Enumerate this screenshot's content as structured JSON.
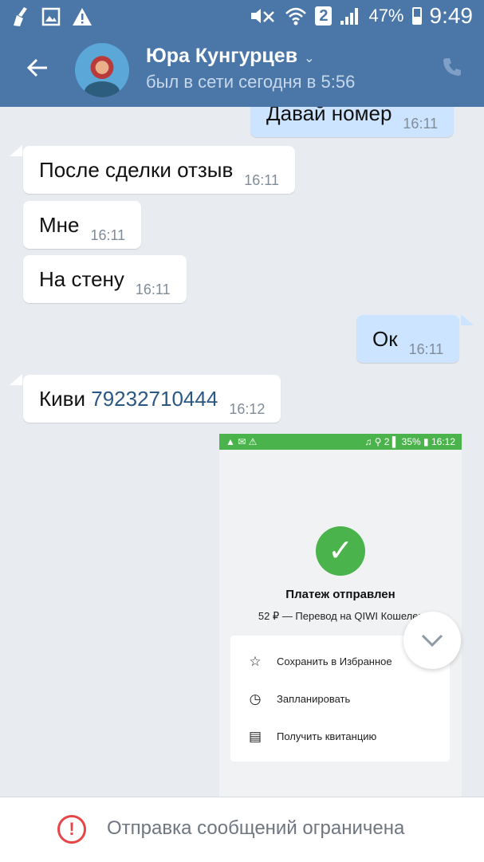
{
  "status_bar": {
    "left_icons": [
      "broom-icon",
      "image-icon",
      "warning-icon"
    ],
    "right_icons": [
      "mute-icon",
      "wifi-icon",
      "signal-icon"
    ],
    "sim": "2",
    "battery": "47%",
    "time": "9:49"
  },
  "header": {
    "contact_name": "Юра Кунгурцев",
    "last_seen": "был в сети сегодня в 5:56"
  },
  "messages": [
    {
      "direction": "out",
      "text": "Давай номер",
      "time": "16:11"
    },
    {
      "direction": "in",
      "text": "После сделки отзыв",
      "time": "16:11"
    },
    {
      "direction": "in",
      "text": "Мне",
      "time": "16:11"
    },
    {
      "direction": "in",
      "text": "На стену",
      "time": "16:11"
    },
    {
      "direction": "out",
      "text": "Ок",
      "time": "16:11"
    },
    {
      "direction": "in",
      "text": "Киви",
      "link": "79232710444",
      "time": "16:12"
    }
  ],
  "screenshot_attachment": {
    "status_bar": {
      "battery": "35%",
      "time": "16:12",
      "sim": "2"
    },
    "title": "Платеж отправлен",
    "subtitle": "52 ₽ — Перевод на QIWI Кошелек",
    "options": [
      {
        "icon": "star-icon",
        "label": "Сохранить в Избранное"
      },
      {
        "icon": "clock-icon",
        "label": "Запланировать"
      },
      {
        "icon": "receipt-icon",
        "label": "Получить квитанцию"
      }
    ]
  },
  "footer": {
    "text": "Отправка сообщений ограничена"
  },
  "colors": {
    "header": "#4a76a8",
    "chat_bg": "#e8ecf1",
    "outgoing_bubble": "#cce4ff",
    "qiwi_green": "#4bb34b",
    "warning_red": "#e64646"
  }
}
